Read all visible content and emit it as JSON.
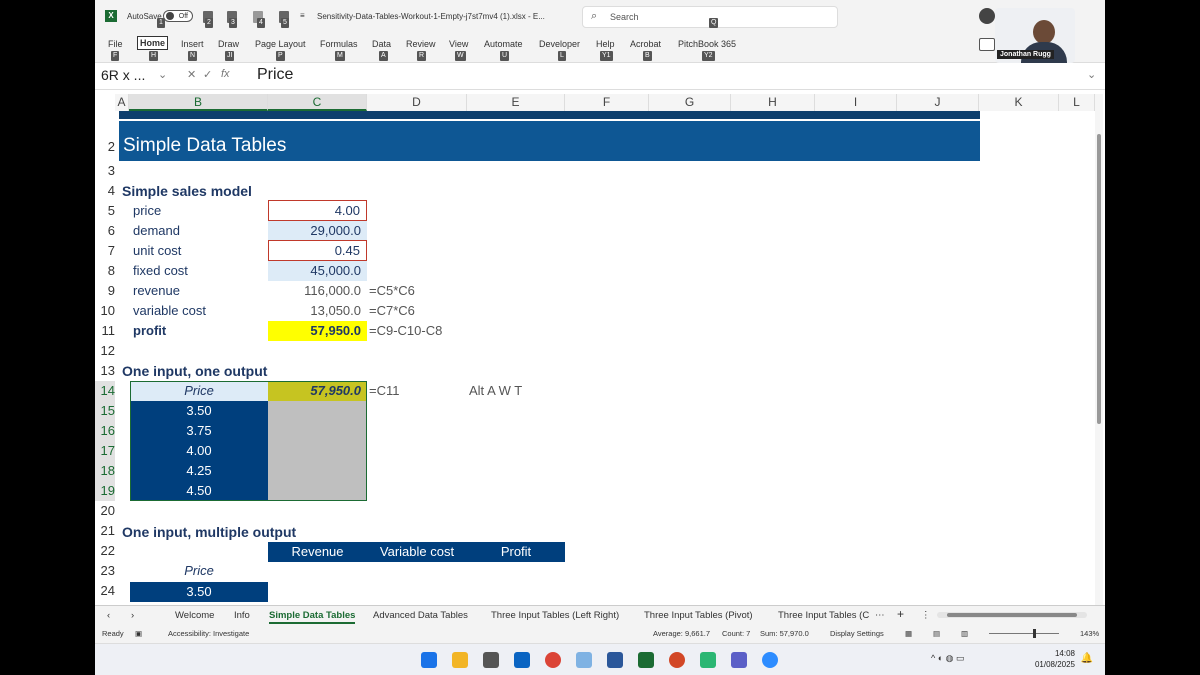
{
  "window": {
    "autosave_label": "AutoSave",
    "autosave_state": "Off",
    "file_title": "Sensitivity-Data-Tables-Workout-1-Empty-j7st7mv4 (1).xlsx  -  E...",
    "search_placeholder": "Search",
    "keytips": {
      "autosave": "1",
      "save": "2",
      "undo": "3",
      "redo": "4",
      "qa5": "5",
      "search": "Q"
    }
  },
  "ribbon": {
    "tabs": [
      {
        "label": "File",
        "key": "F"
      },
      {
        "label": "Home",
        "key": "H"
      },
      {
        "label": "Insert",
        "key": "N"
      },
      {
        "label": "Draw",
        "key": "JI"
      },
      {
        "label": "Page Layout",
        "key": "P"
      },
      {
        "label": "Formulas",
        "key": "M"
      },
      {
        "label": "Data",
        "key": "A"
      },
      {
        "label": "Review",
        "key": "R"
      },
      {
        "label": "View",
        "key": "W"
      },
      {
        "label": "Automate",
        "key": "U"
      },
      {
        "label": "Developer",
        "key": "L"
      },
      {
        "label": "Help",
        "key": "Y1"
      },
      {
        "label": "Acrobat",
        "key": "B"
      },
      {
        "label": "PitchBook 365",
        "key": "Y2"
      }
    ]
  },
  "formula_bar": {
    "name_box": "6R x ...",
    "formula": "Price"
  },
  "grid": {
    "columns": [
      "A",
      "B",
      "C",
      "D",
      "E",
      "F",
      "G",
      "H",
      "I",
      "J",
      "K",
      "L"
    ],
    "rows": [
      "2",
      "3",
      "4",
      "5",
      "6",
      "7",
      "8",
      "9",
      "10",
      "11",
      "12",
      "13",
      "14",
      "15",
      "16",
      "17",
      "18",
      "19",
      "20",
      "21",
      "22",
      "23",
      "24"
    ],
    "title": "Simple Data Tables",
    "section1": "Simple sales model",
    "model": [
      {
        "label": "price",
        "value": "4.00"
      },
      {
        "label": "demand",
        "value": "29,000.0"
      },
      {
        "label": "unit cost",
        "value": "0.45"
      },
      {
        "label": "fixed cost",
        "value": "45,000.0"
      },
      {
        "label": "revenue",
        "value": "116,000.0",
        "formula": "=C5*C6"
      },
      {
        "label": "variable cost",
        "value": "13,050.0",
        "formula": "=C7*C6"
      },
      {
        "label": "profit",
        "value": "57,950.0",
        "formula": "=C9-C10-C8"
      }
    ],
    "section2": "One input, one output",
    "table1_header": "Price",
    "table1_output": "57,950.0",
    "table1_formula": "=C11",
    "table1_note": "Alt A W T",
    "table1_prices": [
      "3.50",
      "3.75",
      "4.00",
      "4.25",
      "4.50"
    ],
    "section3": "One input, multiple output",
    "table2_headers": [
      "Revenue",
      "Variable cost",
      "Profit"
    ],
    "table2_price_label": "Price",
    "table2_first_price": "3.50"
  },
  "sheet_tabs": [
    "Welcome",
    "Info",
    "Simple Data Tables",
    "Advanced Data Tables",
    "Three Input Tables (Left Right)",
    "Three Input Tables (Pivot)",
    "Three Input Tables (C"
  ],
  "active_sheet": "Simple Data Tables",
  "status": {
    "ready": "Ready",
    "accessibility": "Accessibility: Investigate",
    "average": "Average: 9,661.7",
    "count": "Count: 7",
    "sum": "Sum: 57,970.0",
    "display_settings": "Display Settings",
    "zoom": "143%"
  },
  "taskbar": {
    "time": "14:08",
    "date": "01/08/2025"
  },
  "webcam": {
    "name": "Jonathan Rugg"
  },
  "colors": {
    "accent_green": "#1b6b33",
    "header_blue": "#0e5794",
    "table_blue": "#003f7d",
    "highlight_yellow": "#ffff00"
  }
}
